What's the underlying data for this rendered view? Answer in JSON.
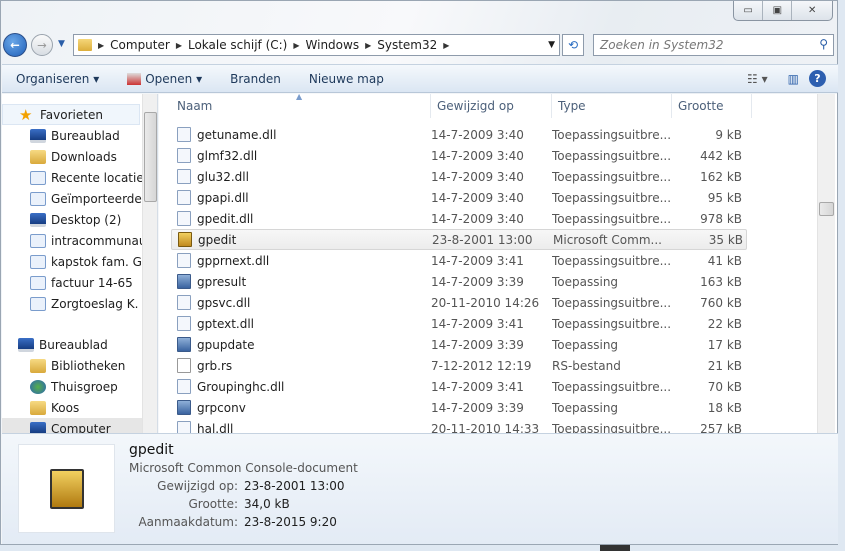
{
  "window": {
    "controls": [
      "minimize",
      "maximize",
      "close"
    ]
  },
  "address": {
    "crumbs": [
      "Computer",
      "Lokale schijf (C:)",
      "Windows",
      "System32"
    ]
  },
  "search": {
    "placeholder": "Zoeken in System32"
  },
  "toolbar": {
    "organize": "Organiseren",
    "open": "Openen",
    "burn": "Branden",
    "new_folder": "Nieuwe map"
  },
  "nav": {
    "favorites_label": "Favorieten",
    "favorites": [
      "Bureaublad",
      "Downloads",
      "Recente locaties",
      "Geïmporteerde af",
      "Desktop (2)",
      "intracommunaut",
      "kapstok fam. Gro",
      "factuur 14-65",
      "Zorgtoeslag K. Vo"
    ],
    "desktop_label": "Bureaublad",
    "desktop": [
      "Bibliotheken",
      "Thuisgroep",
      "Koos",
      "Computer"
    ]
  },
  "columns": [
    "Naam",
    "Gewijzigd op",
    "Type",
    "Grootte"
  ],
  "files": [
    {
      "name": "getuname.dll",
      "date": "14-7-2009 3:40",
      "type": "Toepassingsuitbre...",
      "size": "9 kB",
      "icon": "dll"
    },
    {
      "name": "glmf32.dll",
      "date": "14-7-2009 3:40",
      "type": "Toepassingsuitbre...",
      "size": "442 kB",
      "icon": "dll"
    },
    {
      "name": "glu32.dll",
      "date": "14-7-2009 3:40",
      "type": "Toepassingsuitbre...",
      "size": "162 kB",
      "icon": "dll"
    },
    {
      "name": "gpapi.dll",
      "date": "14-7-2009 3:40",
      "type": "Toepassingsuitbre...",
      "size": "95 kB",
      "icon": "dll"
    },
    {
      "name": "gpedit.dll",
      "date": "14-7-2009 3:40",
      "type": "Toepassingsuitbre...",
      "size": "978 kB",
      "icon": "dll"
    },
    {
      "name": "gpedit",
      "date": "23-8-2001 13:00",
      "type": "Microsoft Comm...",
      "size": "35 kB",
      "icon": "msc",
      "selected": true
    },
    {
      "name": "gpprnext.dll",
      "date": "14-7-2009 3:41",
      "type": "Toepassingsuitbre...",
      "size": "41 kB",
      "icon": "dll"
    },
    {
      "name": "gpresult",
      "date": "14-7-2009 3:39",
      "type": "Toepassing",
      "size": "163 kB",
      "icon": "exe"
    },
    {
      "name": "gpsvc.dll",
      "date": "20-11-2010 14:26",
      "type": "Toepassingsuitbre...",
      "size": "760 kB",
      "icon": "dll"
    },
    {
      "name": "gptext.dll",
      "date": "14-7-2009 3:41",
      "type": "Toepassingsuitbre...",
      "size": "22 kB",
      "icon": "dll"
    },
    {
      "name": "gpupdate",
      "date": "14-7-2009 3:39",
      "type": "Toepassing",
      "size": "17 kB",
      "icon": "exe"
    },
    {
      "name": "grb.rs",
      "date": "7-12-2012 12:19",
      "type": "RS-bestand",
      "size": "21 kB",
      "icon": "txt"
    },
    {
      "name": "Groupinghc.dll",
      "date": "14-7-2009 3:41",
      "type": "Toepassingsuitbre...",
      "size": "70 kB",
      "icon": "dll"
    },
    {
      "name": "grpconv",
      "date": "14-7-2009 3:39",
      "type": "Toepassing",
      "size": "18 kB",
      "icon": "exe"
    },
    {
      "name": "hal.dll",
      "date": "20-11-2010 14:33",
      "type": "Toepassingsuitbre...",
      "size": "257 kB",
      "icon": "dll"
    }
  ],
  "details": {
    "name": "gpedit",
    "type": "Microsoft Common Console-document",
    "fields": [
      {
        "k": "Gewijzigd op:",
        "v": "23-8-2001 13:00"
      },
      {
        "k": "Grootte:",
        "v": "34,0 kB"
      },
      {
        "k": "Aanmaakdatum:",
        "v": "23-8-2015 9:20"
      }
    ]
  }
}
